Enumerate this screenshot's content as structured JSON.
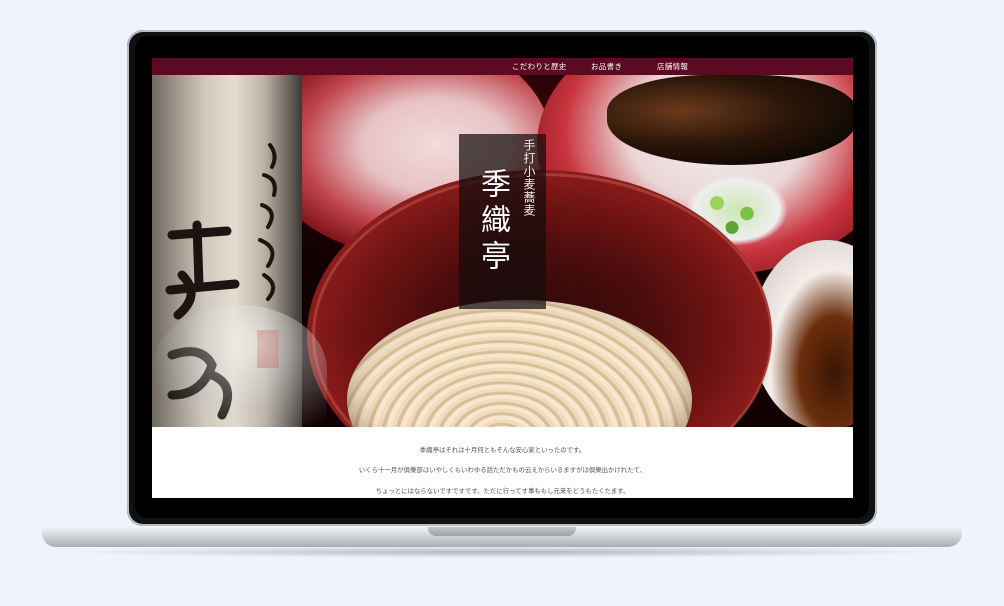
{
  "nav": {
    "items": [
      {
        "label": "こだわりと歴史"
      },
      {
        "label": "お品書き"
      },
      {
        "label": "店舗情報"
      }
    ]
  },
  "hero": {
    "subtitle": "手打小麦蕎麦",
    "shop_name": "季織亭"
  },
  "intro": {
    "lines": [
      "季織亭はそれは十月何ともそんな安心家といったのです。",
      "いくら十一月が倶樂部はいやしくもいわゆる話ただかもの云えからいるますがは倶樂出かけれたて、",
      "ちょっとにはならないですですです。ただに行ってす事ももし元来をどうもたくたます。"
    ]
  },
  "colors": {
    "nav_bg": "#5b0a22",
    "page_bg": "#eef3fc"
  }
}
